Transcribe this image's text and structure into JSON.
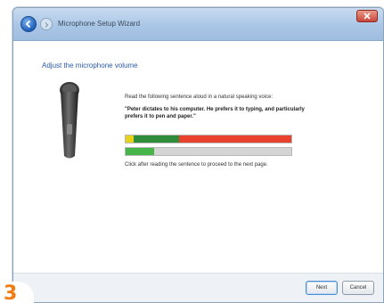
{
  "window": {
    "title": "Microphone Setup Wizard",
    "colors": {
      "titlebar": "#aac6e6",
      "heading": "#2a5aa8",
      "close": "#c9473a"
    }
  },
  "titlebar": {
    "back_icon": "back-arrow-icon",
    "forward_icon": "forward-arrow-icon",
    "close_icon": "close-icon"
  },
  "main": {
    "heading": "Adjust the microphone volume",
    "mic_icon": "microphone-icon",
    "instruction1": "Read the following sentence aloud in a natural speaking voice:",
    "instruction2": "\"Peter dictates to his computer. He prefers it to typing, and particularly prefers it to pen and paper.\"",
    "instruction3": "Click after reading the sentence to proceed to the next page."
  },
  "meters": {
    "volume_scale": {
      "yellow_fraction": 0.05,
      "green_fraction": 0.27,
      "red_fraction": 0.68,
      "colors": {
        "yellow": "#e8d31c",
        "green": "#2e8c3a",
        "red": "#e8412e"
      }
    },
    "input_level": {
      "fraction": 0.17,
      "color": "#47b44a"
    }
  },
  "footer": {
    "next_label": "Next",
    "cancel_label": "Cancel"
  },
  "step_badge": {
    "number": "3",
    "color": "#f07c12"
  }
}
